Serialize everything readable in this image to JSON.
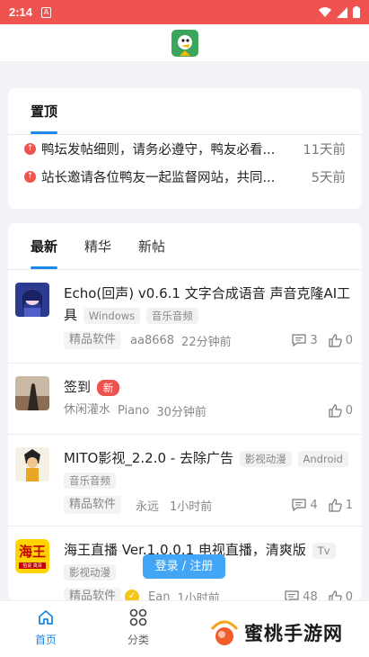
{
  "status_bar": {
    "time": "2:14",
    "sim_label": "A"
  },
  "pinned": {
    "tab_label": "置顶",
    "items": [
      {
        "title": "鸭坛发帖细则，请务必遵守，鸭友必看...",
        "time": "11天前"
      },
      {
        "title": "站长邀请各位鸭友一起监督网站，共同...",
        "time": "5天前"
      }
    ]
  },
  "feed": {
    "tabs": [
      "最新",
      "精华",
      "新帖"
    ],
    "posts": [
      {
        "title": "Echo(回声) v0.6.1 文字合成语音 声音克隆AI工具",
        "tags": [
          "Windows",
          "音乐音频"
        ],
        "category": "精品软件",
        "author": "aa8668",
        "time": "22分钟前",
        "comments": "3",
        "likes": "0"
      },
      {
        "title": "签到",
        "badge": "新",
        "category": "休闲灌水",
        "author": "Piano",
        "time": "30分钟前",
        "likes": "0"
      },
      {
        "title": "MITO影视_2.2.0 - 去除广告",
        "tags": [
          "影视动漫",
          "Android",
          "音乐音频"
        ],
        "category": "精品软件",
        "author": "永远",
        "time": "1小时前",
        "comments": "4",
        "likes": "1"
      },
      {
        "title": "海王直播 Ver.1.0.0.1 电视直播，清爽版",
        "tags": [
          "Tv",
          "影视动漫"
        ],
        "category": "精品软件",
        "author": "Ean",
        "time": "1小时前",
        "comments": "48",
        "likes": "0",
        "avatar_text": "海王",
        "avatar_sub": "怕说 真清"
      }
    ]
  },
  "login_button": "登录 / 注册",
  "bottom_nav": [
    {
      "label": "首页",
      "icon": "home-icon"
    },
    {
      "label": "分类",
      "icon": "grid-icon"
    }
  ],
  "watermark": "蜜桃手游网",
  "colors": {
    "accent": "#1e88e5",
    "status_bar": "#ef5350",
    "badge": "#ef5350"
  }
}
